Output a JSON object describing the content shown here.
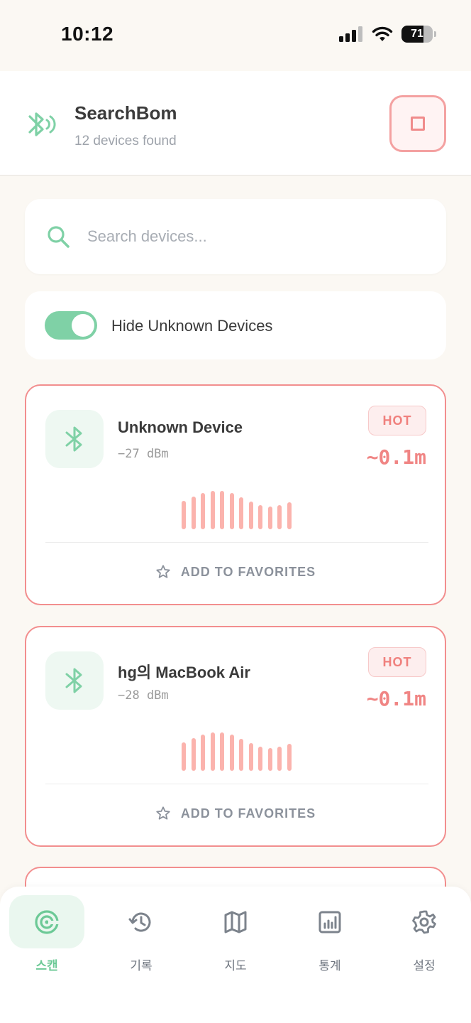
{
  "status_bar": {
    "time": "10:12",
    "battery": "71"
  },
  "header": {
    "title": "SearchBom",
    "subtitle": "12 devices found"
  },
  "search": {
    "placeholder": "Search devices..."
  },
  "filter": {
    "label": "Hide Unknown Devices",
    "enabled": true
  },
  "devices": [
    {
      "name": "Unknown Device",
      "rssi": "−27 dBm",
      "badge": "HOT",
      "distance": "~0.1m",
      "favorite_label": "ADD TO FAVORITES"
    },
    {
      "name": "hg의 MacBook Air",
      "rssi": "−28 dBm",
      "badge": "HOT",
      "distance": "~0.1m",
      "favorite_label": "ADD TO FAVORITES"
    }
  ],
  "nav": {
    "items": [
      {
        "label": "스캔",
        "icon": "radar-icon",
        "active": true
      },
      {
        "label": "기록",
        "icon": "history-icon",
        "active": false
      },
      {
        "label": "지도",
        "icon": "map-icon",
        "active": false
      },
      {
        "label": "통계",
        "icon": "chart-icon",
        "active": false
      },
      {
        "label": "설정",
        "icon": "settings-icon",
        "active": false
      }
    ]
  },
  "colors": {
    "accent_green": "#7fd1a6",
    "hot_red": "#f08584",
    "background": "#fbf8f3"
  }
}
